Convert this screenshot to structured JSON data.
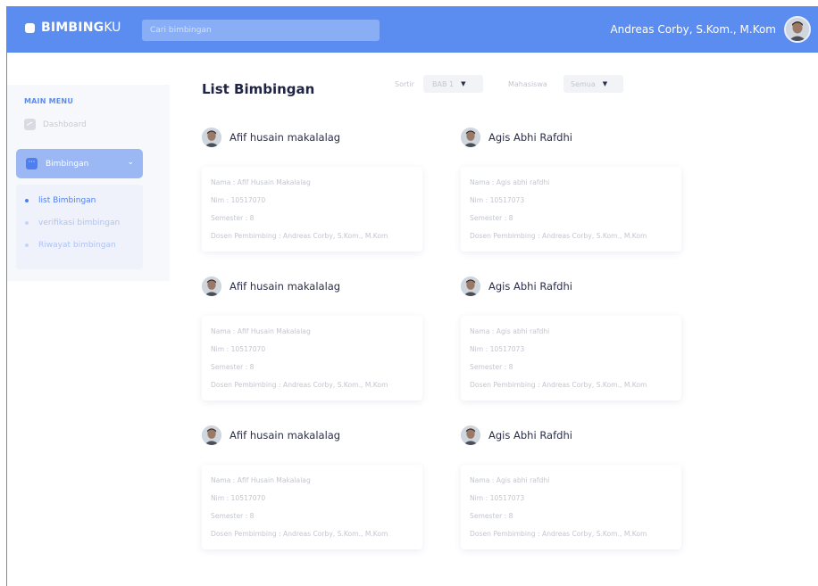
{
  "header": {
    "brand_bold": "BIMBING",
    "brand_light": "KU",
    "search_placeholder": "Cari bimbingan",
    "user_name": "Andreas Corby, S.Kom., M.Kom"
  },
  "sidebar": {
    "section_label": "MAIN MENU",
    "dashboard_label": "Dashboard",
    "bimbingan_label": "Bimbingan",
    "submenu": [
      {
        "label": "list Bimbingan",
        "active": true
      },
      {
        "label": "verifikasi bimbingan",
        "active": false
      },
      {
        "label": "Riwayat bimbingan",
        "active": false
      }
    ]
  },
  "main": {
    "title": "List Bimbingan",
    "sort_label": "Sortir",
    "sort_value": "BAB 1",
    "mahasiswa_label": "Mahasiswa",
    "mahasiswa_value": "Semua"
  },
  "students": [
    {
      "name": "Afif husain makalalag",
      "nama": "Nama : Afif Husain Makalalag",
      "nim": "Nim : 10517070",
      "semester": "Semester : 8",
      "dosen": "Dosen Pembimbing : Andreas Corby, S.Kom., M.Kom"
    },
    {
      "name": "Agis Abhi Rafdhi",
      "nama": "Nama : Agis abhi rafdhi",
      "nim": "Nim : 10517073",
      "semester": "Semester : 8",
      "dosen": "Dosen Pembimbing : Andreas Corby, S.Kom., M.Kom"
    },
    {
      "name": "Afif husain makalalag",
      "nama": "Nama : Afif Husain Makalalag",
      "nim": "Nim : 10517070",
      "semester": "Semester : 8",
      "dosen": "Dosen Pembimbing : Andreas Corby, S.Kom., M.Kom"
    },
    {
      "name": "Agis Abhi Rafdhi",
      "nama": "Nama : Agis abhi rafdhi",
      "nim": "Nim : 10517073",
      "semester": "Semester : 8",
      "dosen": "Dosen Pembimbing : Andreas Corby, S.Kom., M.Kom"
    },
    {
      "name": "Afif husain makalalag",
      "nama": "Nama : Afif Husain Makalalag",
      "nim": "Nim : 10517070",
      "semester": "Semester : 8",
      "dosen": "Dosen Pembimbing : Andreas Corby, S.Kom., M.Kom"
    },
    {
      "name": "Agis Abhi Rafdhi",
      "nama": "Nama : Agis abhi rafdhi",
      "nim": "Nim : 10517073",
      "semester": "Semester : 8",
      "dosen": "Dosen Pembimbing : Andreas Corby, S.Kom., M.Kom"
    }
  ],
  "colors": {
    "accent": "#5b8cf0",
    "active_menu": "#9cb8f4",
    "text_dark": "#1f2447",
    "text_muted": "#c4c6d0"
  },
  "icons": {
    "brand": "brand-square-icon",
    "dashboard": "chart-line-icon",
    "bimbingan": "dots-icon",
    "chevron": "chevron-down-icon"
  }
}
